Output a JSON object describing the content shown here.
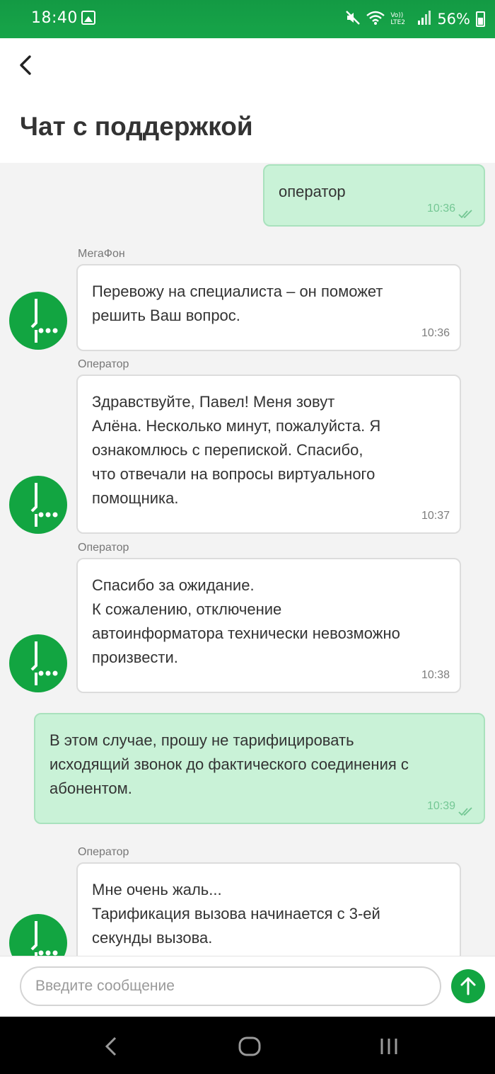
{
  "status_bar": {
    "time": "18:40",
    "network": "Vo)) LTE2",
    "battery": "56%",
    "icons": [
      "image-icon",
      "mute-icon",
      "wifi-icon",
      "signal-icon",
      "battery-icon"
    ]
  },
  "header": {
    "title": "Чат с поддержкой",
    "back_icon": "chevron-left-icon"
  },
  "messages": [
    {
      "direction": "out",
      "text": "оператор",
      "time": "10:36",
      "read": true
    },
    {
      "direction": "in",
      "sender": "МегаФон",
      "text": "Перевожу на специалиста – он поможет\nрешить Ваш вопрос.",
      "time": "10:36"
    },
    {
      "direction": "in",
      "sender": "Оператор",
      "text": "Здравствуйте, Павел! Меня зовут\nАлёна. Несколько минут, пожалуйста. Я\nознакомлюсь с перепиской. Спасибо,\nчто отвечали на вопросы виртуального\nпомощника.",
      "time": "10:37"
    },
    {
      "direction": "in",
      "sender": "Оператор",
      "text": "Спасибо за ожидание.\nК сожалению, отключение\nавтоинформатора технически невозможно\nпроизвести.",
      "time": "10:38"
    },
    {
      "direction": "out",
      "text": "В этом случае, прошу не тарифицировать\nисходящий звонок до фактического соединения с\nабонентом.",
      "time": "10:39",
      "read": true
    },
    {
      "direction": "in",
      "sender": "Оператор",
      "text": "Мне очень жаль...\nТарификация вызова начинается с 3-ей\nсекунды вызова.",
      "time": ""
    }
  ],
  "input": {
    "placeholder": "Введите сообщение"
  },
  "colors": {
    "brand_green": "#12a541",
    "outgoing_bubble": "#c9f2d7",
    "incoming_bubble": "#ffffff",
    "chat_background": "#f3f3f3"
  }
}
